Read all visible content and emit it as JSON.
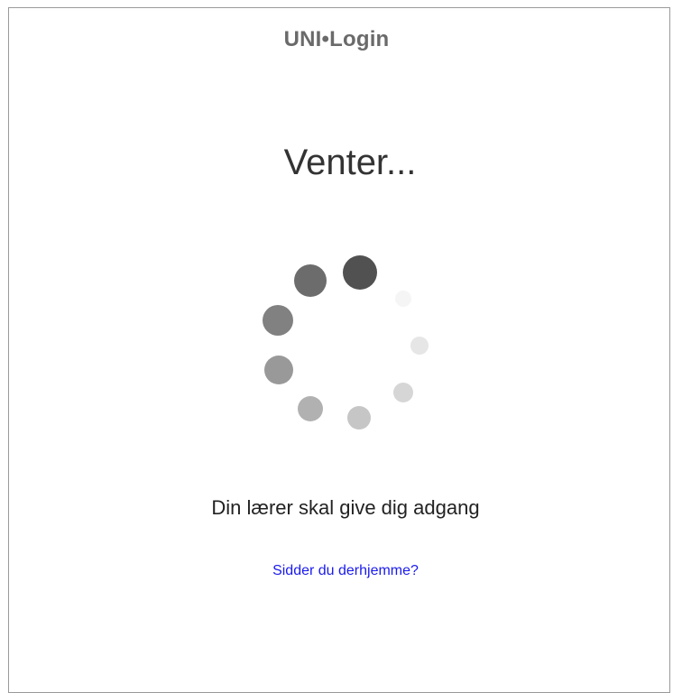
{
  "header": {
    "brand": "UNI•Login"
  },
  "main": {
    "heading": "Venter...",
    "message": "Din lærer skal give dig adgang",
    "help_link": "Sidder du derhjemme?"
  },
  "spinner": {
    "icon": "loading-spinner-icon",
    "dot_opacities": [
      0.85,
      0.05,
      0.12,
      0.2,
      0.28,
      0.38,
      0.5,
      0.62,
      0.72
    ],
    "color": "#333333"
  },
  "colors": {
    "brand_text": "#6a6a6a",
    "link": "#1a1aee",
    "border": "#9a9a9a"
  }
}
